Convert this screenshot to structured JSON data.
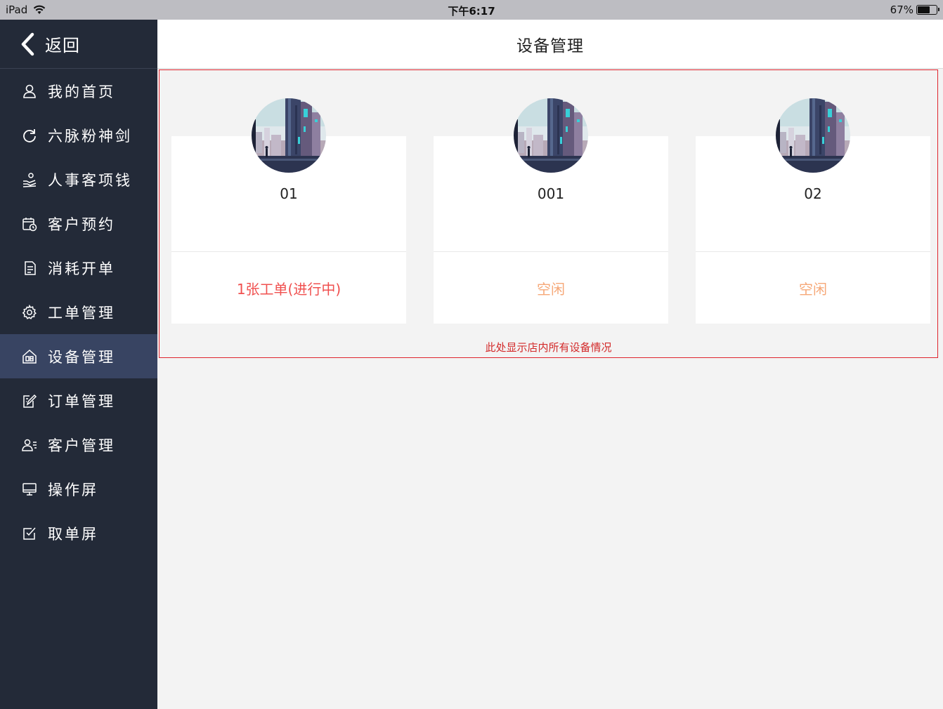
{
  "status_bar": {
    "device": "iPad",
    "time": "下午6:17",
    "battery": "67%",
    "battery_level": 0.67
  },
  "sidebar": {
    "back_label": "返回",
    "items": [
      {
        "label": "我的首页",
        "icon": "user-icon"
      },
      {
        "label": "六脉粉神剑",
        "icon": "refresh-icon"
      },
      {
        "label": "人事客项钱",
        "icon": "hand-coins-icon"
      },
      {
        "label": "客户预约",
        "icon": "calendar-clock-icon"
      },
      {
        "label": "消耗开单",
        "icon": "document-icon"
      },
      {
        "label": "工单管理",
        "icon": "gear-icon"
      },
      {
        "label": "设备管理",
        "icon": "device-home-icon",
        "active": true
      },
      {
        "label": "订单管理",
        "icon": "edit-note-icon"
      },
      {
        "label": "客户管理",
        "icon": "user-list-icon"
      },
      {
        "label": "操作屏",
        "icon": "monitor-icon"
      },
      {
        "label": "取单屏",
        "icon": "checkbox-icon"
      }
    ]
  },
  "header": {
    "title": "设备管理"
  },
  "devices": [
    {
      "name": "01",
      "status": "1张工单(进行中)",
      "status_color": "#f0504f"
    },
    {
      "name": "001",
      "status": "空闲",
      "status_color": "#f6a878"
    },
    {
      "name": "02",
      "status": "空闲",
      "status_color": "#f6a878"
    }
  ],
  "footer_note": "此处显示店内所有设备情况",
  "colors": {
    "sidebar_bg": "#232a38",
    "sidebar_active": "#384462",
    "annotation_red": "#e0242d"
  }
}
